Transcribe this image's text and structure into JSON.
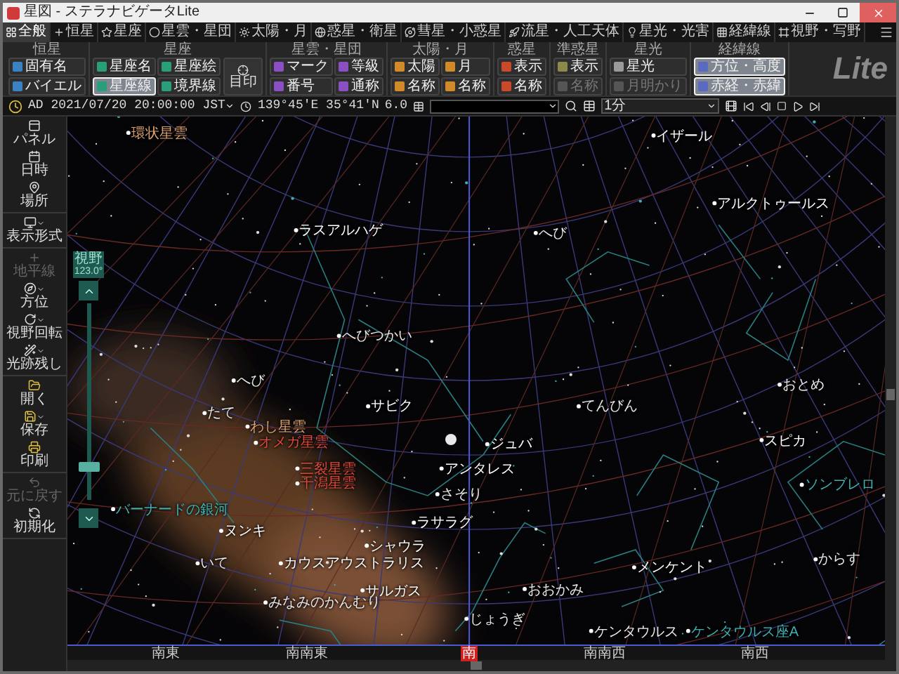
{
  "window": {
    "title": "星図 - ステラナビゲータLite"
  },
  "tabs": [
    {
      "label": "全般",
      "selected": true
    },
    {
      "label": "恒星",
      "selected": false
    },
    {
      "label": "星座",
      "selected": false
    },
    {
      "label": "星雲・星団",
      "selected": false
    },
    {
      "label": "太陽・月",
      "selected": false
    },
    {
      "label": "惑星・衛星",
      "selected": false
    },
    {
      "label": "彗星・小惑星",
      "selected": false
    },
    {
      "label": "流星・人工天体",
      "selected": false
    },
    {
      "label": "星光・光害",
      "selected": false
    },
    {
      "label": "経緯線",
      "selected": false
    },
    {
      "label": "視野・写野",
      "selected": false
    }
  ],
  "ribbon": {
    "logo_text": "Lite",
    "groups": [
      {
        "title": "恒星",
        "buttons": [
          {
            "label": "固有名",
            "on": false,
            "disabled": false
          },
          {
            "label": "バイエル",
            "on": false,
            "disabled": false
          }
        ]
      },
      {
        "title": "星座",
        "buttons": [
          {
            "label": "星座名",
            "on": false,
            "disabled": false
          },
          {
            "label": "星座線",
            "on": true,
            "disabled": false
          },
          {
            "label": "星座絵",
            "on": false,
            "disabled": false
          },
          {
            "label": "境界線",
            "on": false,
            "disabled": false
          }
        ],
        "tall_button": {
          "label": "目印",
          "on": false
        }
      },
      {
        "title": "星雲・星団",
        "buttons": [
          {
            "label": "マーク",
            "on": false,
            "disabled": false
          },
          {
            "label": "番号",
            "on": false,
            "disabled": false
          },
          {
            "label": "等級",
            "on": false,
            "disabled": false
          },
          {
            "label": "通称",
            "on": false,
            "disabled": false
          }
        ]
      },
      {
        "title": "太陽・月",
        "buttons": [
          {
            "label": "太陽",
            "on": false,
            "disabled": false
          },
          {
            "label": "名称",
            "on": false,
            "disabled": false
          },
          {
            "label": "月",
            "on": false,
            "disabled": false
          },
          {
            "label": "名称",
            "on": false,
            "disabled": false
          }
        ]
      },
      {
        "title": "惑星",
        "buttons": [
          {
            "label": "表示",
            "on": false,
            "disabled": false
          },
          {
            "label": "名称",
            "on": false,
            "disabled": false
          }
        ]
      },
      {
        "title": "準惑星",
        "buttons": [
          {
            "label": "表示",
            "on": false,
            "disabled": false
          },
          {
            "label": "名称",
            "on": false,
            "disabled": true
          }
        ]
      },
      {
        "title": "星光",
        "buttons": [
          {
            "label": "星光",
            "on": false,
            "disabled": false
          },
          {
            "label": "月明かり",
            "on": false,
            "disabled": true
          }
        ]
      },
      {
        "title": "経緯線",
        "buttons": [
          {
            "label": "方位・高度",
            "on": true,
            "disabled": false
          },
          {
            "label": "赤経・赤緯",
            "on": true,
            "disabled": false
          }
        ]
      }
    ]
  },
  "toolbar": {
    "datetime": "AD 2021/07/20 20:00:00 JST",
    "location": "139°45'E 35°41'N",
    "magnitude": "6.0",
    "interval": "1分"
  },
  "sidebar": {
    "groups": [
      {
        "items": [
          {
            "label": "パネル",
            "disabled": false,
            "menu": false
          },
          {
            "label": "日時",
            "disabled": false,
            "menu": false
          },
          {
            "label": "場所",
            "disabled": false,
            "menu": false
          }
        ]
      },
      {
        "items": [
          {
            "label": "表示形式",
            "disabled": false,
            "menu": true
          }
        ]
      },
      {
        "items": [
          {
            "label": "地平線",
            "disabled": true,
            "menu": false
          },
          {
            "label": "方位",
            "disabled": false,
            "menu": true
          },
          {
            "label": "視野回転",
            "disabled": false,
            "menu": true
          },
          {
            "label": "光跡残し",
            "disabled": false,
            "menu": true
          }
        ]
      },
      {
        "items": [
          {
            "label": "開く",
            "disabled": false,
            "menu": false
          },
          {
            "label": "保存",
            "disabled": false,
            "menu": true
          },
          {
            "label": "印刷",
            "disabled": false,
            "menu": false
          }
        ]
      },
      {
        "items": [
          {
            "label": "元に戻す",
            "disabled": true,
            "menu": false
          },
          {
            "label": "初期化",
            "disabled": false,
            "menu": false
          }
        ]
      }
    ]
  },
  "zoom_control": {
    "label": "視野",
    "value": "123.0°",
    "level": 0.15
  },
  "chart": {
    "labels": [
      {
        "text": "環状星雲",
        "kind": "nebula"
      },
      {
        "text": "イザール",
        "kind": "star"
      },
      {
        "text": "アルクトゥールス",
        "kind": "star"
      },
      {
        "text": "ラスアルハゲ",
        "kind": "star"
      },
      {
        "text": "へび",
        "kind": "constellation"
      },
      {
        "text": "へびつかい",
        "kind": "constellation"
      },
      {
        "text": "へび",
        "kind": "constellation"
      },
      {
        "text": "たて",
        "kind": "constellation"
      },
      {
        "text": "わし星雲",
        "kind": "nebula"
      },
      {
        "text": "オメガ星雲",
        "kind": "nebula_red"
      },
      {
        "text": "三裂星雲",
        "kind": "nebula_red"
      },
      {
        "text": "干潟星雲",
        "kind": "nebula_red"
      },
      {
        "text": "サビク",
        "kind": "star"
      },
      {
        "text": "てんびん",
        "kind": "constellation"
      },
      {
        "text": "おとめ",
        "kind": "constellation"
      },
      {
        "text": "ジュバ",
        "kind": "star"
      },
      {
        "text": "アンタレス",
        "kind": "star"
      },
      {
        "text": "スピカ",
        "kind": "star"
      },
      {
        "text": "さそり",
        "kind": "constellation"
      },
      {
        "text": "ソンブレロ",
        "kind": "galaxy"
      },
      {
        "text": "バーナードの銀河",
        "kind": "galaxy"
      },
      {
        "text": "ラサラグ",
        "kind": "star"
      },
      {
        "text": "ヌンキ",
        "kind": "star"
      },
      {
        "text": "シャウラ",
        "kind": "star"
      },
      {
        "text": "いて",
        "kind": "constellation"
      },
      {
        "text": "カウスアウストラリス",
        "kind": "star"
      },
      {
        "text": "メンケント",
        "kind": "star"
      },
      {
        "text": "からす",
        "kind": "constellation"
      },
      {
        "text": "サルガス",
        "kind": "star"
      },
      {
        "text": "おおかみ",
        "kind": "constellation"
      },
      {
        "text": "みなみのかんむり",
        "kind": "constellation"
      },
      {
        "text": "じょうぎ",
        "kind": "constellation"
      },
      {
        "text": "ケンタウルス",
        "kind": "constellation"
      },
      {
        "text": "ケンタウルス座A",
        "kind": "galaxy"
      }
    ]
  },
  "compass": [
    {
      "label": "南東",
      "selected": false
    },
    {
      "label": "南南東",
      "selected": false
    },
    {
      "label": "南",
      "selected": true
    },
    {
      "label": "南南西",
      "selected": false
    },
    {
      "label": "南西",
      "selected": false
    }
  ]
}
